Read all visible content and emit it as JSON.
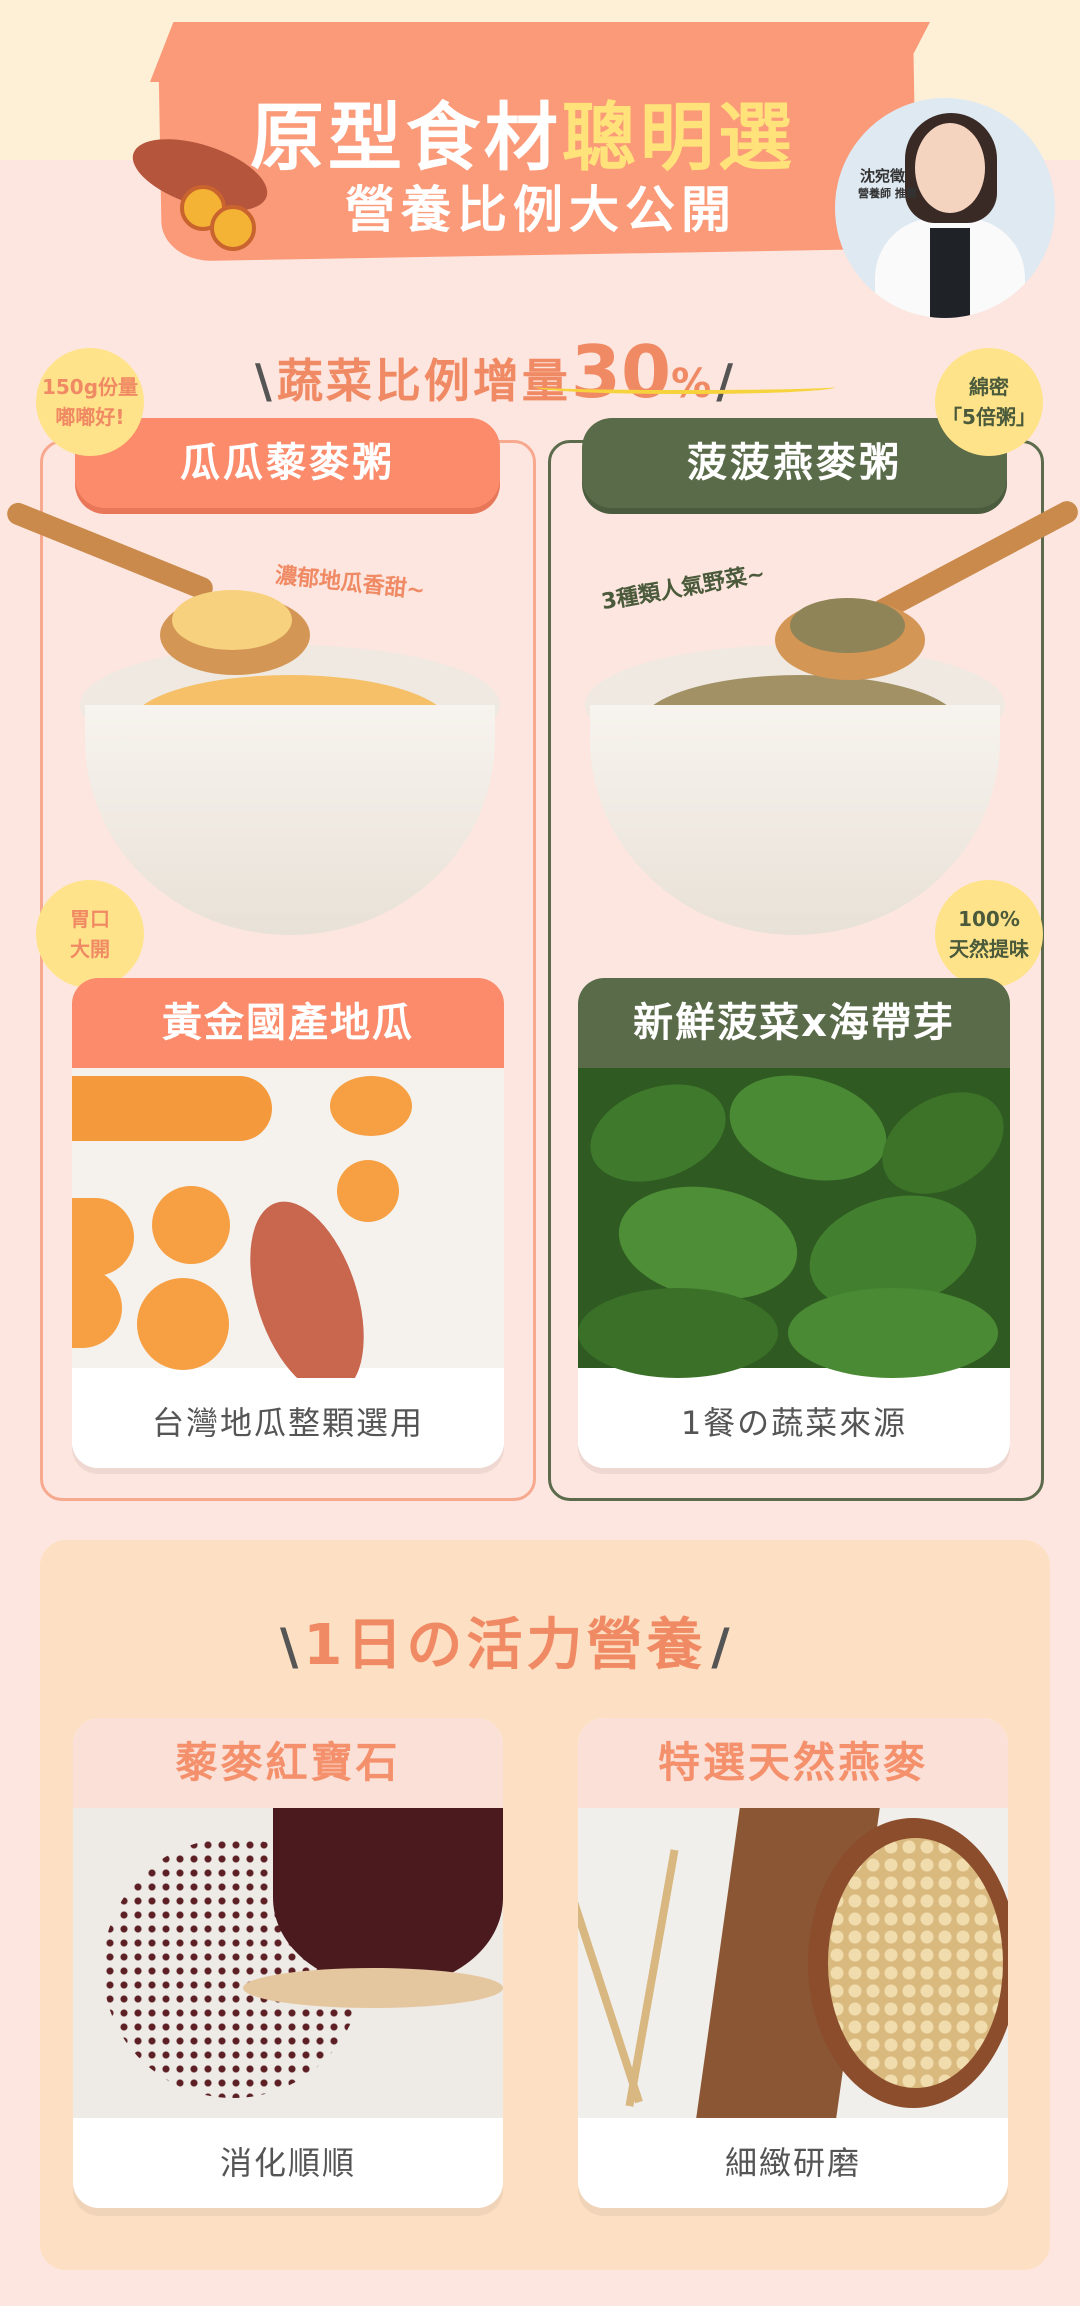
{
  "header": {
    "title_part1": "原型食材",
    "title_part2": "聰明選",
    "subtitle": "營養比例大公開",
    "doctor_name": "沈宛徵",
    "doctor_title": "營養師 推薦"
  },
  "section1": {
    "prefix": "\\",
    "text": "蔬菜比例增量",
    "number": "30",
    "unit": "%",
    "suffix": "/"
  },
  "left": {
    "badge_top": [
      "150g份量",
      "嘟嘟好!"
    ],
    "name": "瓜瓜藜麥粥",
    "note": "濃郁地瓜香甜~",
    "badge_mid": [
      "胃口",
      "大開"
    ],
    "card_title": "黃金國產地瓜",
    "card_caption": "台灣地瓜整顆選用"
  },
  "right": {
    "badge_top": [
      "綿密",
      "「5倍粥」"
    ],
    "name": "菠菠燕麥粥",
    "note": "3種類人氣野菜~",
    "badge_mid": [
      "100%",
      "天然提味"
    ],
    "card_title": "新鮮菠菜x海帶芽",
    "card_caption": "1餐の蔬菜來源"
  },
  "section2": {
    "prefix": "\\",
    "text": "1日の活力營養",
    "suffix": "/",
    "cards": [
      {
        "title": "藜麥紅寶石",
        "caption": "消化順順"
      },
      {
        "title": "特選天然燕麥",
        "caption": "細緻研磨"
      }
    ]
  },
  "colors": {
    "accent": "#fb8b6b",
    "green": "#5a6b4a",
    "background": "#fde6df",
    "highlight": "#ffe27a"
  }
}
